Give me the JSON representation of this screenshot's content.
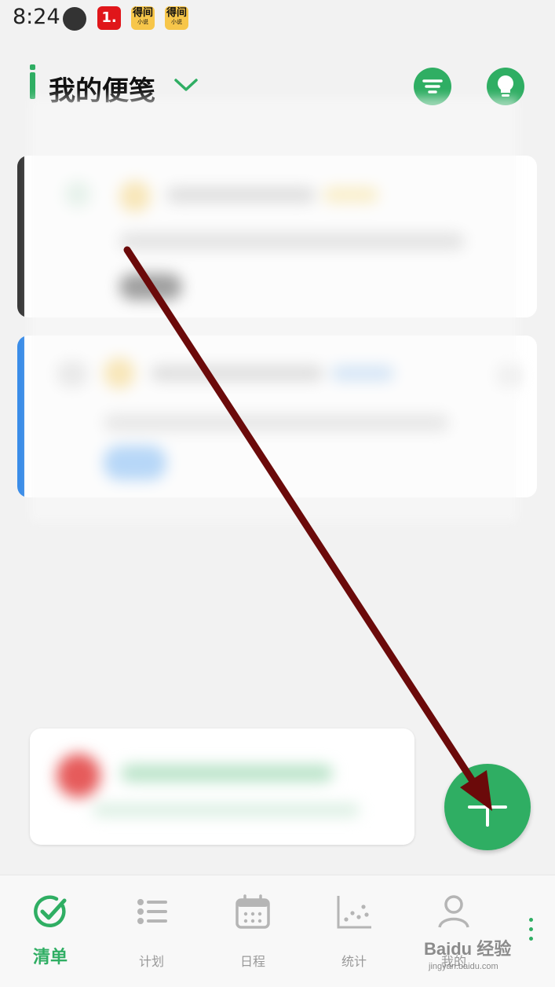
{
  "status_bar": {
    "time": "8:24",
    "badges": [
      {
        "label": "1.",
        "sub": ""
      },
      {
        "label": "得间",
        "sub": "小说"
      },
      {
        "label": "得间",
        "sub": "小说"
      }
    ]
  },
  "header": {
    "title": "我的便笺",
    "icons": [
      "filter-icon",
      "lightbulb-icon"
    ]
  },
  "colors": {
    "accent": "#2fae63",
    "card1_bar": "#3a3a3a",
    "card2_bar": "#3b8de8",
    "annotation_arrow": "#6b0a0a"
  },
  "tabs": [
    {
      "label": "清单",
      "icon": "check-circle-icon",
      "active": true
    },
    {
      "label": "计划",
      "icon": "list-icon",
      "active": false
    },
    {
      "label": "日程",
      "icon": "calendar-icon",
      "active": false
    },
    {
      "label": "统计",
      "icon": "scatter-chart-icon",
      "active": false
    },
    {
      "label": "我的",
      "icon": "person-icon",
      "active": false
    }
  ],
  "fab": {
    "icon": "plus-icon"
  },
  "watermark": {
    "main": "Baidu 经验",
    "sub": "jingyan.baidu.com"
  }
}
